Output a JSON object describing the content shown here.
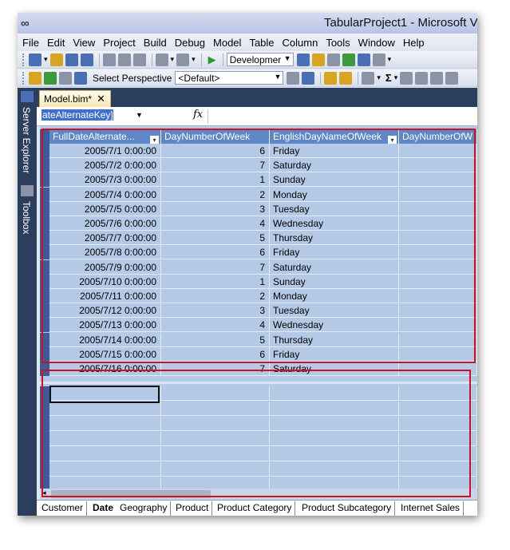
{
  "window": {
    "title": "TabularProject1 - Microsoft V",
    "app_icon": "∞"
  },
  "menu": [
    "File",
    "Edit",
    "View",
    "Project",
    "Build",
    "Debug",
    "Model",
    "Table",
    "Column",
    "Tools",
    "Window",
    "Help"
  ],
  "toolbar1": {
    "config_dropdown": "Developmer"
  },
  "toolbar2": {
    "perspective_label": "Select Perspective",
    "perspective_value": "<Default>",
    "sigma": "Σ"
  },
  "side_rail": {
    "server_explorer": "Server Explorer",
    "toolbox": "Toolbox"
  },
  "doc_tab": {
    "label": "Model.bim*",
    "close": "✕"
  },
  "formula_bar": {
    "name_box": "ateAlternateKey]",
    "fx": "fx"
  },
  "grid": {
    "columns": [
      "FullDateAlternate...",
      "DayNumberOfWeek",
      "EnglishDayNameOfWeek",
      "DayNumberOfW"
    ],
    "rows": [
      [
        "2005/7/1 0:00:00",
        "6",
        "Friday"
      ],
      [
        "2005/7/2 0:00:00",
        "7",
        "Saturday"
      ],
      [
        "2005/7/3 0:00:00",
        "1",
        "Sunday"
      ],
      [
        "2005/7/4 0:00:00",
        "2",
        "Monday"
      ],
      [
        "2005/7/5 0:00:00",
        "3",
        "Tuesday"
      ],
      [
        "2005/7/6 0:00:00",
        "4",
        "Wednesday"
      ],
      [
        "2005/7/7 0:00:00",
        "5",
        "Thursday"
      ],
      [
        "2005/7/8 0:00:00",
        "6",
        "Friday"
      ],
      [
        "2005/7/9 0:00:00",
        "7",
        "Saturday"
      ],
      [
        "2005/7/10 0:00:00",
        "1",
        "Sunday"
      ],
      [
        "2005/7/11 0:00:00",
        "2",
        "Monday"
      ],
      [
        "2005/7/12 0:00:00",
        "3",
        "Tuesday"
      ],
      [
        "2005/7/13 0:00:00",
        "4",
        "Wednesday"
      ],
      [
        "2005/7/14 0:00:00",
        "5",
        "Thursday"
      ],
      [
        "2005/7/15 0:00:00",
        "6",
        "Friday"
      ],
      [
        "2005/7/16 0:00:00",
        "7",
        "Saturday"
      ]
    ]
  },
  "sheet_tabs": [
    "Customer",
    "Date",
    "Geography",
    "Product",
    "Product Category",
    "Product Subcategory",
    "Internet Sales"
  ],
  "active_sheet": "Date",
  "colors": {
    "highlight": "#d01020",
    "header": "#5e87c8",
    "grid": "#b4c9e6"
  }
}
